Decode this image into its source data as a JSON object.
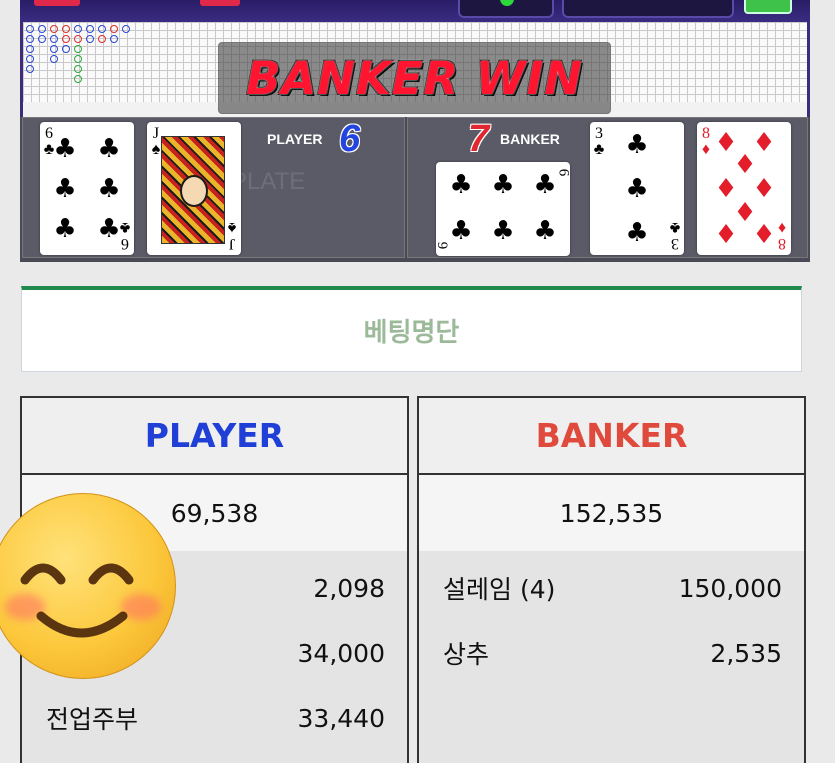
{
  "game": {
    "result_banner": "BANKER WIN",
    "player": {
      "label": "PLAYER",
      "score": "6"
    },
    "banker": {
      "label": "BANKER",
      "score": "7"
    },
    "watermark": "PLATE",
    "player_cards": [
      {
        "rank": "6",
        "suit": "♣",
        "color": "#000000"
      },
      {
        "rank": "J",
        "suit": "♠",
        "color": "#000000"
      }
    ],
    "banker_cards": [
      {
        "rank": "6",
        "suit": "♣",
        "color": "#000000",
        "rotated": true
      },
      {
        "rank": "3",
        "suit": "♣",
        "color": "#000000"
      },
      {
        "rank": "8",
        "suit": "♦",
        "color": "#e41d2b"
      }
    ],
    "colors": {
      "banner_text": "#ff1530",
      "player": "#2444e0",
      "banker": "#e0262f",
      "felt": "#3b2d7c"
    }
  },
  "betlist": {
    "title": "베팅명단",
    "player": {
      "header": "PLAYER",
      "total": "69,538",
      "rows": [
        {
          "name": "",
          "amount": "2,098"
        },
        {
          "name": "",
          "amount": "34,000"
        },
        {
          "name": "전업주부",
          "amount": "33,440"
        }
      ]
    },
    "banker": {
      "header": "BANKER",
      "total": "152,535",
      "rows": [
        {
          "name": "설레임 (4)",
          "amount": "150,000"
        },
        {
          "name": "상추",
          "amount": "2,535"
        }
      ]
    },
    "colors": {
      "player_header": "#1f3fd6",
      "banker_header": "#e04a3c",
      "accent_line": "#1f8a4c",
      "title": "#9cba9a"
    }
  },
  "overlay": {
    "icon": "smiling-face-emoji"
  }
}
